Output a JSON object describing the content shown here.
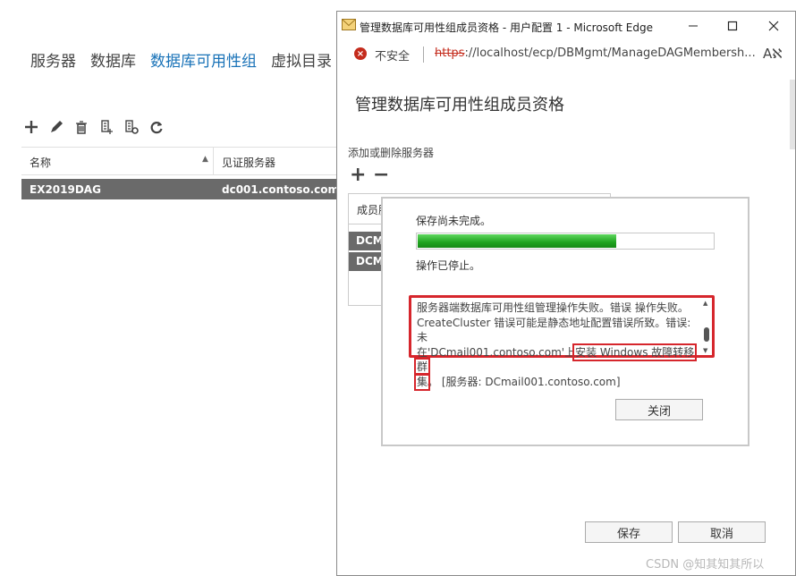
{
  "nav": {
    "items": [
      "服务器",
      "数据库",
      "数据库可用性组",
      "虚拟目录"
    ],
    "active_index": 2
  },
  "toolbar": {
    "icons": [
      "add-icon",
      "edit-icon",
      "delete-icon",
      "manage-membership-icon",
      "network-settings-icon",
      "refresh-icon"
    ]
  },
  "dag_grid": {
    "columns": [
      "名称",
      "见证服务器"
    ],
    "rows": [
      {
        "name": "EX2019DAG",
        "witness": "dc001.contoso.com"
      }
    ]
  },
  "browser": {
    "window_title": "管理数据库可用性组成员资格 - 用户配置 1 - Microsoft Edge",
    "security_label": "不安全",
    "url_protocol": "https",
    "url_rest": "://localhost/ecp/DBMgmt/ManageDAGMembersh...",
    "reader_label": "Aℵ"
  },
  "dialog_page": {
    "title": "管理数据库可用性组成员资格",
    "section_label": "添加或删除服务器",
    "add_label": "+",
    "remove_label": "−",
    "members_header": "成员服",
    "member_rows": [
      "DCM",
      "DCM"
    ],
    "save_label": "保存",
    "cancel_label": "取消"
  },
  "progress_dialog": {
    "status_text": "保存尚未完成。",
    "progress_percent": 67,
    "stopped_text": "操作已停止。",
    "error_line1": "服务器端数据库可用性组管理操作失败。错误 操作失败。",
    "error_line2": "CreateCluster 错误可能是静态地址配置错误所致。错误: 未",
    "error_line3a": "在'DCmail001.contoso.com'上",
    "error_highlight1": "安装 Windows 故障转移群",
    "error_highlight2": "集",
    "error_line4": "。 [服务器: DCmail001.contoso.com]",
    "close_label": "关闭"
  },
  "colors": {
    "accent_blue": "#1a73b8",
    "error_red": "#d6262c",
    "progress_green": "#1fa31f",
    "row_gray": "#6a6a6a"
  },
  "watermark": "CSDN @知其知其所以"
}
